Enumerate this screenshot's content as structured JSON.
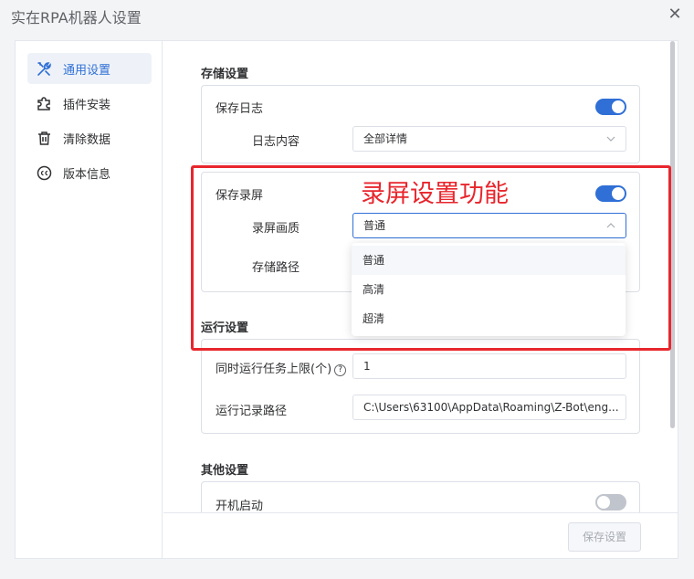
{
  "window": {
    "title": "实在RPA机器人设置",
    "close_icon": "✕"
  },
  "sidebar": {
    "items": [
      {
        "label": "通用设置",
        "icon": "tools-icon",
        "active": true
      },
      {
        "label": "插件安装",
        "icon": "puzzle-icon",
        "active": false
      },
      {
        "label": "清除数据",
        "icon": "trash-icon",
        "active": false
      },
      {
        "label": "版本信息",
        "icon": "cc-icon",
        "active": false
      }
    ]
  },
  "storage": {
    "title": "存储设置",
    "save_log": {
      "label": "保存日志",
      "enabled": true
    },
    "log_content": {
      "label": "日志内容",
      "value": "全部详情"
    },
    "save_recording": {
      "label": "保存录屏",
      "enabled": true
    },
    "recording_quality": {
      "label": "录屏画质",
      "value": "普通",
      "options": [
        "普通",
        "高清",
        "超清"
      ]
    },
    "storage_path": {
      "label": "存储路径"
    }
  },
  "run": {
    "title": "运行设置",
    "max_tasks": {
      "label": "同时运行任务上限(个)",
      "help": "?",
      "value": "1"
    },
    "record_path": {
      "label": "运行记录路径",
      "value": "C:\\Users\\63100\\AppData\\Roaming\\Z-Bot\\eng..."
    }
  },
  "other": {
    "title": "其他设置",
    "autostart": {
      "label": "开机启动",
      "enabled": false
    }
  },
  "footer": {
    "save_label": "保存设置"
  },
  "annotation": {
    "text": "录屏设置功能"
  },
  "colors": {
    "accent": "#2f6fd6",
    "annotation": "#e8262d"
  }
}
